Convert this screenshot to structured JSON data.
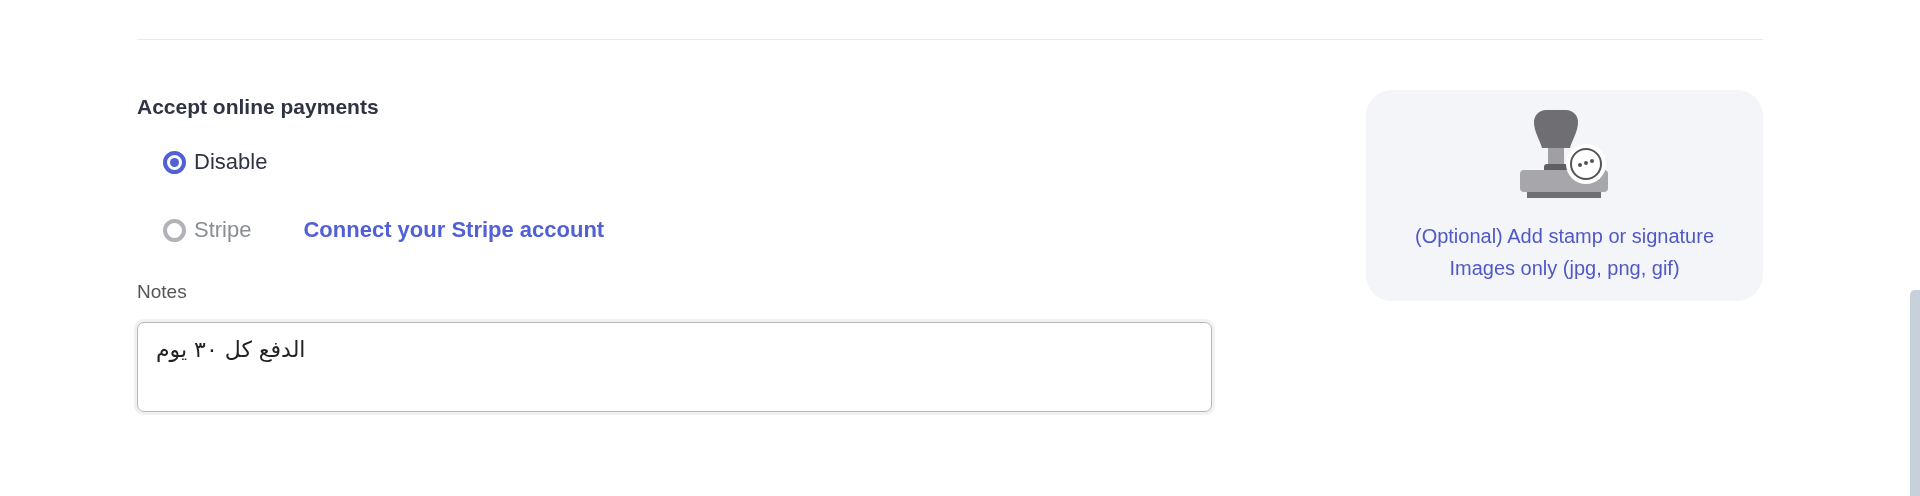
{
  "payments": {
    "title": "Accept online payments",
    "options": [
      {
        "label": "Disable",
        "selected": true,
        "disabled": false
      },
      {
        "label": "Stripe",
        "selected": false,
        "disabled": true,
        "link": "Connect your Stripe account"
      }
    ]
  },
  "notes": {
    "label": "Notes",
    "value": "الدفع كل ٣٠ يوم"
  },
  "stamp": {
    "lines": [
      "(Optional) Add stamp or signature",
      "Images only (jpg, png, gif)"
    ]
  }
}
